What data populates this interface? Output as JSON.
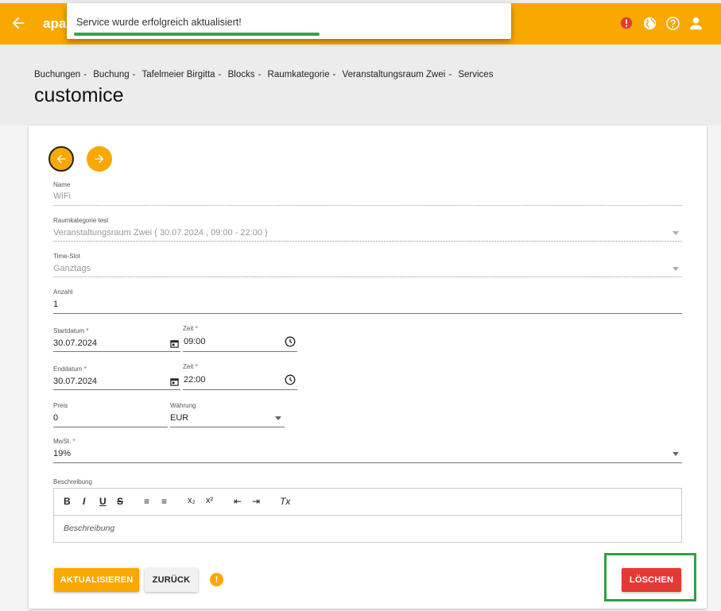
{
  "app": {
    "brand": "apa"
  },
  "toast": {
    "message": "Service wurde erfolgreich aktualisiert!"
  },
  "breadcrumb": [
    "Buchungen",
    "Buchung",
    "Tafelmeier Birgitta",
    "Blocks",
    "Raumkategorie",
    "Veranstaltungsraum Zwei",
    "Services"
  ],
  "breadcrumb_sep": "-",
  "page_title": "customice",
  "form": {
    "name": {
      "label": "Name",
      "value": "WiFi"
    },
    "raumkategorie": {
      "label": "Raumkategorie test",
      "value": "Veranstaltungsraum Zwei ( 30.07.2024 , 09:00 - 22:00 )"
    },
    "timeslot": {
      "label": "Time-Slot",
      "value": "Ganztags"
    },
    "anzahl": {
      "label": "Anzahl",
      "value": "1"
    },
    "startdatum": {
      "label": "Startdatum",
      "value": "30.07.2024"
    },
    "startzeit": {
      "label": "Zeit",
      "value": "09:00"
    },
    "enddatum": {
      "label": "Enddatum",
      "value": "30.07.2024"
    },
    "endzeit": {
      "label": "Zeit",
      "value": "22:00"
    },
    "preis": {
      "label": "Preis",
      "value": "0"
    },
    "waehrung": {
      "label": "Währung",
      "value": "EUR"
    },
    "mwst": {
      "label": "MwSt.",
      "value": "19%"
    },
    "beschreibung": {
      "label": "Beschreibung",
      "placeholder": "Beschreibung"
    },
    "required_mark": "*"
  },
  "editor_toolbar": {
    "bold": "B",
    "italic": "I",
    "underline": "U",
    "strike": "S",
    "ordered_list": "≡",
    "bullet_list": "≡",
    "subscript": "x₂",
    "superscript": "x²",
    "outdent": "⇤",
    "indent": "⇥",
    "clear": "Tx"
  },
  "buttons": {
    "update": "AKTUALISIEREN",
    "back": "ZURÜCK",
    "info": "!",
    "delete": "LÖSCHEN"
  },
  "colors": {
    "primary": "#f9a800",
    "danger": "#e53935",
    "success": "#2ea043",
    "alert": "#e53935"
  },
  "icons": [
    "arrow-back-icon",
    "alert-icon",
    "globe-icon",
    "help-icon",
    "user-icon",
    "calendar-icon",
    "clock-icon",
    "arrow-left-icon",
    "arrow-right-icon",
    "info-icon"
  ]
}
